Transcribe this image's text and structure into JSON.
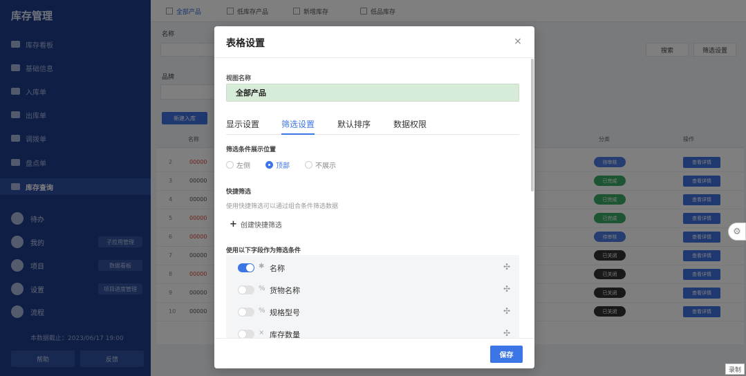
{
  "app": {
    "sidebar_title": "库存管理",
    "sidebar_items": [
      "库存看板",
      "基础信息",
      "入库单",
      "出库单",
      "调拨单",
      "盘点单",
      "库存查询"
    ],
    "sidebar_apps": [
      "待办",
      "我的",
      "项目",
      "设置",
      "流程"
    ],
    "sidebar_pills": [
      "子应用管理",
      "数据看板",
      "项目进度管理"
    ],
    "sidebar_footer": "本数据截止：2023/06/17 19:00",
    "sidebar_buttons": [
      "帮助",
      "反馈"
    ],
    "tabs": [
      "全部产品",
      "低库存产品",
      "新增库存",
      "低品库存"
    ],
    "filter_labels": [
      "名称",
      "品牌"
    ],
    "filter_buttons": [
      "搜索",
      "筛选设置"
    ],
    "new_button": "新建入库",
    "table_header": [
      "名称",
      "分类",
      "操作"
    ],
    "rows": [
      {
        "num": "2",
        "code": "00000",
        "red": true,
        "status": "待审核",
        "color": "#4a7ae0"
      },
      {
        "num": "3",
        "code": "00000",
        "red": false,
        "status": "已完成",
        "color": "#3aa864"
      },
      {
        "num": "4",
        "code": "00000",
        "red": false,
        "status": "已完成",
        "color": "#3aa864"
      },
      {
        "num": "5",
        "code": "00000",
        "red": true,
        "status": "已完成",
        "color": "#3aa864"
      },
      {
        "num": "6",
        "code": "00000",
        "red": true,
        "status": "待审核",
        "color": "#4a7ae0"
      },
      {
        "num": "7",
        "code": "00000",
        "red": false,
        "status": "已关闭",
        "color": "#333333"
      },
      {
        "num": "8",
        "code": "00000",
        "red": true,
        "status": "已关闭",
        "color": "#333333"
      },
      {
        "num": "9",
        "code": "00000",
        "red": false,
        "status": "已关闭",
        "color": "#333333"
      },
      {
        "num": "10",
        "code": "00000",
        "red": false,
        "status": "已关闭",
        "color": "#333333"
      }
    ],
    "op_label": "查看详情",
    "record_label": "录制"
  },
  "modal": {
    "title": "表格设置",
    "view_name_label": "视图名称",
    "view_name_value": "全部产品",
    "tabs": [
      "显示设置",
      "筛选设置",
      "默认排序",
      "数据权限"
    ],
    "active_tab": "筛选设置",
    "filter_position_title": "筛选条件展示位置",
    "filter_positions": [
      {
        "label": "左侧",
        "checked": false
      },
      {
        "label": "顶部",
        "checked": true
      },
      {
        "label": "不展示",
        "checked": false
      }
    ],
    "quick_filter_title": "快捷筛选",
    "quick_filter_hint": "使用快捷筛选可以通过组合条件筛选数据",
    "create_quick_filter": "创建快捷筛选",
    "fields_title": "使用以下字段作为筛选条件",
    "fields": [
      {
        "name": "名称",
        "type_icon": "asterisk-icon",
        "type_glyph": "✱",
        "enabled": true
      },
      {
        "name": "货物名称",
        "type_icon": "link-icon",
        "type_glyph": "%",
        "enabled": false
      },
      {
        "name": "规格型号",
        "type_icon": "link-icon",
        "type_glyph": "%",
        "enabled": false
      },
      {
        "name": "库存数量",
        "type_icon": "number-icon",
        "type_glyph": "×",
        "enabled": false
      }
    ],
    "save_label": "保存",
    "close_glyph": "×"
  },
  "colors": {
    "accent": "#3c76e6",
    "view_name_bg": "#d7ecd8",
    "sidebar": "#1f3d8a"
  }
}
